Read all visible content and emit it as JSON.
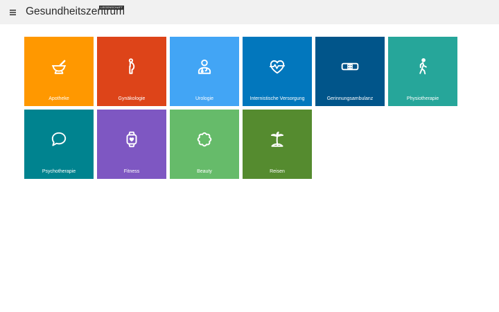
{
  "header": {
    "menu_icon": "hamburger-menu-icon",
    "title": "Gesundheitszentrum",
    "badge": "LIEGENSCHAFT",
    "background": "#f1f1f1"
  },
  "tiles": [
    {
      "label": "Apotheke",
      "icon": "mortar-pestle-icon",
      "color": "#ff9800"
    },
    {
      "label": "Gynäkologie",
      "icon": "pregnant-woman-icon",
      "color": "#dd4419"
    },
    {
      "label": "Urologie",
      "icon": "doctor-icon",
      "color": "#42a5f5"
    },
    {
      "label": "Internistische Versorgung",
      "icon": "heartbeat-icon",
      "color": "#0277bd"
    },
    {
      "label": "Gerinnungsambulanz",
      "icon": "bandage-icon",
      "color": "#01558a"
    },
    {
      "label": "Physiotherapie",
      "icon": "walking-person-icon",
      "color": "#26a69a"
    },
    {
      "label": "Psychotherapie",
      "icon": "speech-bubble-icon",
      "color": "#00838f"
    },
    {
      "label": "Fitness",
      "icon": "smartwatch-heart-icon",
      "color": "#7e57c2"
    },
    {
      "label": "Beauty",
      "icon": "flower-icon",
      "color": "#66bb6a"
    },
    {
      "label": "Reisen",
      "icon": "palm-island-icon",
      "color": "#558b2f"
    }
  ]
}
